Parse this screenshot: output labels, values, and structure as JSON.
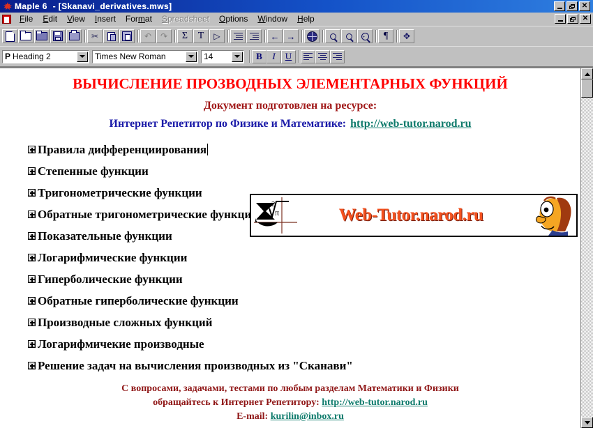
{
  "window": {
    "app_title": "Maple 6",
    "document_title": "- [Skanavi_derivatives.mws]",
    "app_icon": "maple-leaf-icon",
    "minimize_label": "_",
    "maximize_label": "❐",
    "close_label": "✕"
  },
  "menu": {
    "icon": "document-control-icon",
    "items": [
      {
        "label": "File",
        "enabled": true
      },
      {
        "label": "Edit",
        "enabled": true
      },
      {
        "label": "View",
        "enabled": true
      },
      {
        "label": "Insert",
        "enabled": true
      },
      {
        "label": "Format",
        "enabled": true
      },
      {
        "label": "Spreadsheet",
        "enabled": false
      },
      {
        "label": "Options",
        "enabled": true
      },
      {
        "label": "Window",
        "enabled": true
      },
      {
        "label": "Help",
        "enabled": true
      }
    ]
  },
  "toolbar": {
    "buttons": [
      {
        "name": "new-document-icon",
        "tip": "New"
      },
      {
        "name": "open-folder-icon",
        "tip": "Open"
      },
      {
        "name": "open-url-icon",
        "tip": "Open URL"
      },
      {
        "name": "save-disk-icon",
        "tip": "Save"
      },
      {
        "name": "print-icon",
        "tip": "Print"
      },
      {
        "name": "cut-scissors-icon",
        "tip": "Cut"
      },
      {
        "name": "copy-icon",
        "tip": "Copy"
      },
      {
        "name": "paste-icon",
        "tip": "Paste"
      },
      {
        "name": "undo-icon",
        "tip": "Undo"
      },
      {
        "name": "redo-icon",
        "tip": "Redo"
      },
      {
        "name": "sigma-math-icon",
        "tip": "Math input"
      },
      {
        "name": "text-input-icon",
        "tip": "Text input"
      },
      {
        "name": "execute-icon",
        "tip": "Execute"
      },
      {
        "name": "outdent-icon",
        "tip": "Outdent"
      },
      {
        "name": "indent-icon",
        "tip": "Indent"
      },
      {
        "name": "back-arrow-icon",
        "tip": "Back"
      },
      {
        "name": "forward-arrow-icon",
        "tip": "Forward"
      },
      {
        "name": "globe-icon",
        "tip": "Hyperlink"
      },
      {
        "name": "zoom-out-icon",
        "tip": "Zoom out"
      },
      {
        "name": "zoom-normal-icon",
        "tip": "Zoom 100%"
      },
      {
        "name": "zoom-in-icon",
        "tip": "Zoom in"
      },
      {
        "name": "pilcrow-icon",
        "tip": "Show nonprinting"
      },
      {
        "name": "move-icon",
        "tip": "Move"
      }
    ],
    "undo_glyph": "↶",
    "redo_glyph": "↷",
    "sigma_glyph": "Σ",
    "text_glyph": "T",
    "execute_glyph": "▷",
    "back_glyph": "←",
    "forward_glyph": "→",
    "pilcrow_glyph": "¶",
    "move_glyph": "✥",
    "scissors_glyph": "✂",
    "zoom_out_label": "-",
    "zoom_normal_label": "",
    "zoom_in_label": "+"
  },
  "formatbar": {
    "style": {
      "prefix": "P",
      "value": "Heading 2"
    },
    "font": {
      "value": "Times New Roman"
    },
    "size": {
      "value": "14"
    },
    "bold_label": "B",
    "italic_label": "I",
    "underline_label": "U",
    "align_left": "align-left-icon",
    "align_center": "align-center-icon",
    "align_right": "align-right-icon"
  },
  "document": {
    "title": "ВЫЧИСЛЕНИЕ ПРОЗВОДНЫХ ЭЛЕМЕНТАРНЫХ ФУНКЦИЙ",
    "subtitle": "Документ подготовлен на ресурсе:",
    "resource_line": "Интернет Репетитор по Физике и Математике:",
    "resource_link": "http://web-tutor.narod.ru",
    "sections": [
      "Правила дифференциирования",
      "Степенные функции",
      "Тригонометрические функции",
      "Обратные тригонометрические функции",
      "Показательные функции",
      "Логарифмические функции",
      "Гиперболические функции",
      "Обратные гиперболические функции",
      "Производные сложных функций",
      "Логарифмичекие производные",
      "Решение задач на вычисления производных из \"Сканави\""
    ],
    "banner": {
      "text": "Web-Tutor.narod.ru",
      "logo_icon": "sigma-radical-logo-icon",
      "logo_sigma": "Σ",
      "logo_index": "2",
      "logo_radicand": "π",
      "face_icon": "cartoon-face-icon"
    },
    "footer": {
      "line1": "С вопросами, задачами, тестами по любым разделам  Математики и Физики",
      "line2_prefix": "обращайтесь к Интернет Репетитору:",
      "line2_link": "http://web-tutor.narod.ru",
      "line3_prefix": "E-mail:",
      "line3_link": "kurilin@inbox.ru"
    }
  },
  "scrollbar": {
    "up_label": "▲",
    "down_label": "▼"
  },
  "colors": {
    "title_red": "#ff0000",
    "subtitle_dark_red": "#a01818",
    "resource_blue": "#1a1aa8",
    "link_teal": "#0f7b6c",
    "banner_orange": "#f4511e",
    "titlebar_blue": "#0a1e8c",
    "chrome_gray": "#c0c0c0"
  }
}
